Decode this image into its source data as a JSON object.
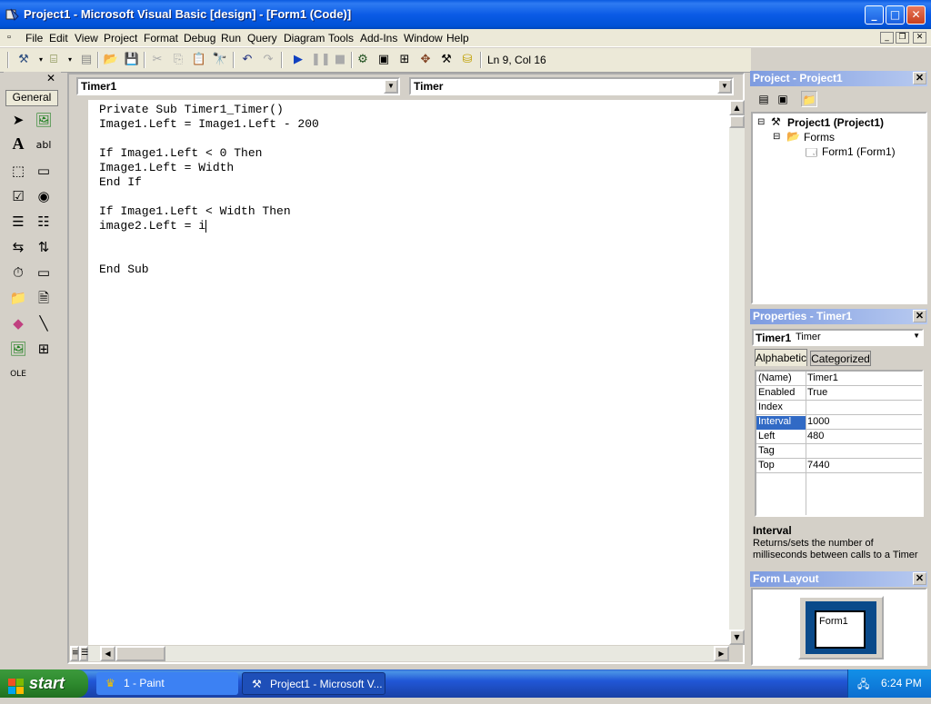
{
  "window": {
    "title": "Project1 - Microsoft Visual Basic [design] - [Form1 (Code)]"
  },
  "menu": [
    "File",
    "Edit",
    "View",
    "Project",
    "Format",
    "Debug",
    "Run",
    "Query",
    "Diagram",
    "Tools",
    "Add-Ins",
    "Window",
    "Help"
  ],
  "toolbar": {
    "position": "Ln 9, Col 16"
  },
  "toolbox": {
    "tab_label": "General"
  },
  "code": {
    "object_combo": "Timer1",
    "procedure_combo": "Timer",
    "lines": [
      "Private Sub Timer1_Timer()",
      "Image1.Left = Image1.Left - 200",
      "",
      "If Image1.Left < 0 Then",
      "Image1.Left = Width",
      "End If",
      "",
      "If Image1.Left < Width Then",
      "image2.Left = i",
      "",
      "",
      "End Sub"
    ]
  },
  "project": {
    "title": "Project - Project1",
    "root": "Project1 (Project1)",
    "folder": "Forms",
    "form": "Form1 (Form1)"
  },
  "properties": {
    "title": "Properties - Timer1",
    "object_name": "Timer1",
    "object_type": "Timer",
    "tabs": [
      "Alphabetic",
      "Categorized"
    ],
    "rows": [
      {
        "name": "(Name)",
        "value": "Timer1"
      },
      {
        "name": "Enabled",
        "value": "True"
      },
      {
        "name": "Index",
        "value": ""
      },
      {
        "name": "Interval",
        "value": "1000"
      },
      {
        "name": "Left",
        "value": "480"
      },
      {
        "name": "Tag",
        "value": ""
      },
      {
        "name": "Top",
        "value": "7440"
      }
    ],
    "selected_row": "Interval",
    "desc_title": "Interval",
    "desc_text": "Returns/sets the number of milliseconds between calls to a Timer"
  },
  "form_layout": {
    "title": "Form Layout",
    "form_label": "Form1"
  },
  "taskbar": {
    "start": "start",
    "tasks": [
      "1 - Paint",
      "Project1 - Microsoft V..."
    ],
    "clock": "6:24 PM"
  },
  "colors": {
    "accent": "#0a5ae0",
    "selection": "#316ac5",
    "start_green": "#2e8a2e"
  }
}
